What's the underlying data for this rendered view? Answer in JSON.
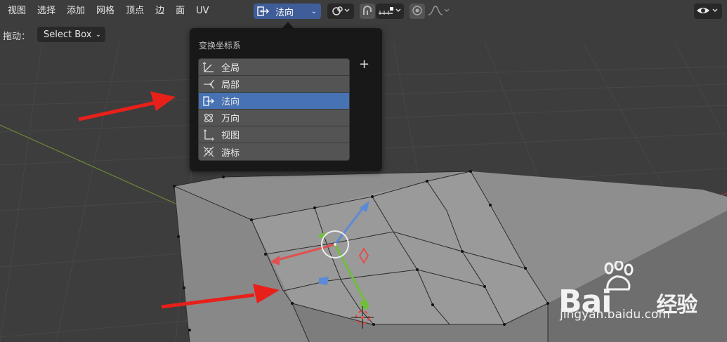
{
  "menu": {
    "items": [
      "视图",
      "选择",
      "添加",
      "网格",
      "顶点",
      "边",
      "面",
      "UV"
    ]
  },
  "header": {
    "orientation_label": "法向",
    "drag_label": "拖动：",
    "drag_value": "Select Box"
  },
  "popup": {
    "title": "变换坐标系",
    "add_symbol": "+",
    "items": [
      {
        "label": "全局",
        "icon": "global-axes-icon",
        "active": false
      },
      {
        "label": "局部",
        "icon": "local-axes-icon",
        "active": false
      },
      {
        "label": "法向",
        "icon": "normal-axes-icon",
        "active": true
      },
      {
        "label": "万向",
        "icon": "gimbal-axes-icon",
        "active": false
      },
      {
        "label": "视图",
        "icon": "view-axes-icon",
        "active": false
      },
      {
        "label": "游标",
        "icon": "cursor-axes-icon",
        "active": false
      }
    ]
  },
  "watermark": {
    "brand_a": "Bai",
    "brand_b": "经验",
    "url": "jingyan.baidu.com"
  },
  "colors": {
    "active_blue": "#4772b3",
    "annotation_red": "#e8201a",
    "x_axis": "#a03a3a",
    "y_axis": "#6a8a3a"
  }
}
